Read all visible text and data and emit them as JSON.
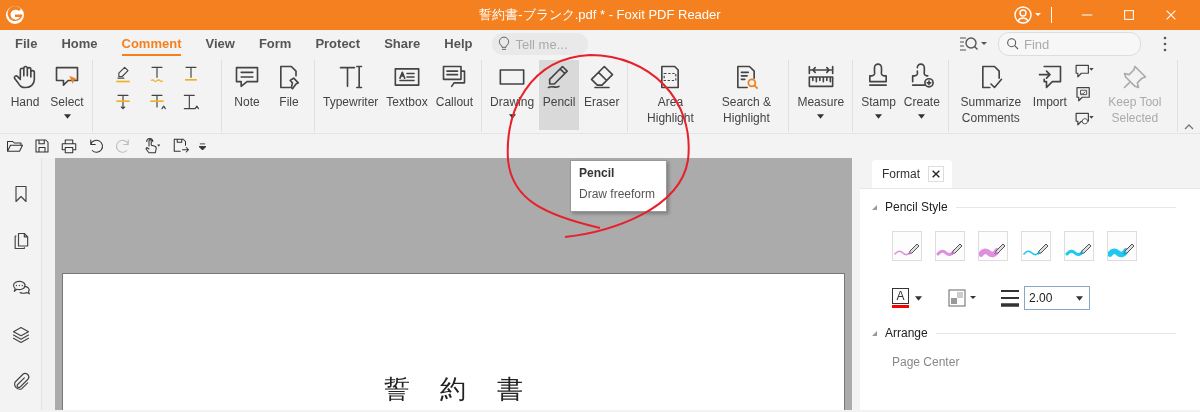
{
  "window": {
    "title": "誓約書-ブランク.pdf * - Foxit PDF Reader"
  },
  "menu": [
    {
      "label": "File",
      "selected": false
    },
    {
      "label": "Home",
      "selected": false
    },
    {
      "label": "Comment",
      "selected": true
    },
    {
      "label": "View",
      "selected": false
    },
    {
      "label": "Form",
      "selected": false
    },
    {
      "label": "Protect",
      "selected": false
    },
    {
      "label": "Share",
      "selected": false
    },
    {
      "label": "Help",
      "selected": false
    }
  ],
  "tell_me": {
    "placeholder": "Tell me..."
  },
  "find": {
    "placeholder": "Find"
  },
  "ribbon": [
    {
      "kind": "tools",
      "tools": [
        {
          "kind": "big",
          "label": "Hand",
          "dropdown": false,
          "selected": false,
          "disabled": false
        },
        {
          "kind": "big",
          "label": "Select",
          "dropdown": true,
          "selected": false,
          "disabled": false
        }
      ]
    },
    {
      "kind": "icon-grid"
    },
    {
      "kind": "tools",
      "tools": [
        {
          "kind": "big",
          "label": "Note",
          "dropdown": false,
          "selected": false,
          "disabled": false
        },
        {
          "kind": "big",
          "label": "File",
          "dropdown": false,
          "selected": false,
          "disabled": false
        }
      ]
    },
    {
      "kind": "tools",
      "tools": [
        {
          "kind": "big",
          "label": "Typewriter",
          "dropdown": false,
          "selected": false,
          "disabled": false
        },
        {
          "kind": "big",
          "label": "Textbox",
          "dropdown": false,
          "selected": false,
          "disabled": false
        },
        {
          "kind": "big",
          "label": "Callout",
          "dropdown": false,
          "selected": false,
          "disabled": false
        }
      ]
    },
    {
      "kind": "tools",
      "tools": [
        {
          "kind": "big",
          "label": "Drawing",
          "dropdown": true,
          "selected": false,
          "disabled": false
        },
        {
          "kind": "big",
          "label": "Pencil",
          "dropdown": false,
          "selected": true,
          "disabled": false
        },
        {
          "kind": "big",
          "label": "Eraser",
          "dropdown": false,
          "selected": false,
          "disabled": false
        }
      ]
    },
    {
      "kind": "tools",
      "tools": [
        {
          "kind": "big",
          "label": "Area Highlight",
          "dropdown": false,
          "selected": false,
          "disabled": false
        },
        {
          "kind": "big",
          "label": "Search & Highlight",
          "dropdown": false,
          "selected": false,
          "disabled": false
        }
      ]
    },
    {
      "kind": "tools",
      "tools": [
        {
          "kind": "big",
          "label": "Measure",
          "dropdown": true,
          "selected": false,
          "disabled": false
        }
      ]
    },
    {
      "kind": "tools",
      "tools": [
        {
          "kind": "big",
          "label": "Stamp",
          "dropdown": true,
          "selected": false,
          "disabled": false
        },
        {
          "kind": "big",
          "label": "Create",
          "dropdown": true,
          "selected": false,
          "disabled": false
        }
      ]
    },
    {
      "kind": "tools",
      "tools": [
        {
          "kind": "big",
          "label": "Summarize Comments",
          "dropdown": false,
          "selected": false,
          "disabled": false
        },
        {
          "kind": "big",
          "label": "Import",
          "dropdown": false,
          "selected": false,
          "disabled": false
        },
        {
          "kind": "stack"
        },
        {
          "kind": "big",
          "label": "Keep Tool Selected",
          "dropdown": false,
          "selected": false,
          "disabled": true
        }
      ]
    }
  ],
  "quick_access": [
    {
      "disabled": false
    },
    {
      "disabled": false
    },
    {
      "disabled": false
    },
    {
      "disabled": false
    },
    {
      "disabled": true
    },
    {
      "disabled": false
    },
    {
      "disabled": false
    }
  ],
  "tooltip": {
    "title": "Pencil",
    "text": "Draw freeform"
  },
  "document": {
    "heading": "誓 約 書"
  },
  "panel": {
    "tabs": [
      {
        "label": "Format",
        "selected": true
      }
    ],
    "pencil_style": {
      "title": "Pencil Style",
      "swatches": [
        {
          "color": "#e08ee0",
          "kind": "thin",
          "selected": false
        },
        {
          "color": "#e08ee0",
          "kind": "medium",
          "selected": false
        },
        {
          "color": "#e08ee0",
          "kind": "thick",
          "selected": false
        },
        {
          "color": "#1ec8f0",
          "kind": "thin",
          "selected": false
        },
        {
          "color": "#1ec8f0",
          "kind": "medium",
          "selected": false
        },
        {
          "color": "#1ec8f0",
          "kind": "thick",
          "selected": false
        }
      ]
    },
    "line_color": {
      "glyph": "A",
      "color": "#ff0000"
    },
    "thickness": {
      "value": "2.00"
    },
    "arrange": {
      "title": "Arrange",
      "subtitle": "Page Center"
    }
  }
}
